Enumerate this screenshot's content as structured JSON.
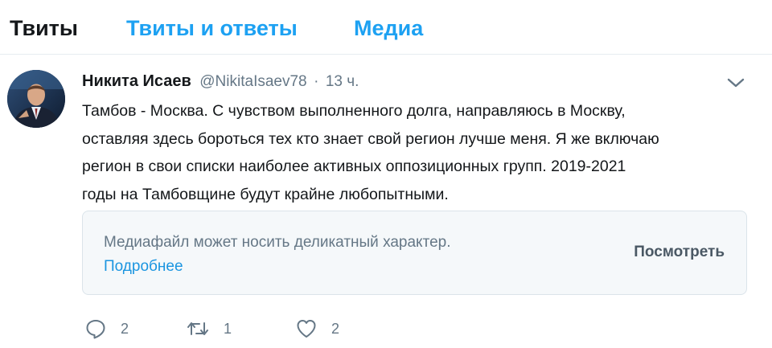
{
  "tabs": [
    {
      "label": "Твиты",
      "active": true
    },
    {
      "label": "Твиты и ответы",
      "active": false
    },
    {
      "label": "Медиа",
      "active": false
    }
  ],
  "tweet": {
    "author_name": "Никита Исаев",
    "handle": "@NikitaIsaev78",
    "separator": "·",
    "time": "13 ч.",
    "text": "Тамбов - Москва. С чувством выполненного долга, направляюсь в Москву,\nоставляя здесь бороться тех кто знает свой регион лучше меня. Я же включаю\nрегион в свои списки наиболее активных оппозиционных групп. 2019-2021\nгоды на Тамбовщине будут крайне любопытными.",
    "media": {
      "notice": "Медиафайл может носить деликатный характер.",
      "more_link": "Подробнее",
      "view_button": "Посмотреть"
    },
    "actions": {
      "replies": "2",
      "retweets": "1",
      "likes": "2"
    }
  },
  "icons": {
    "menu": "chevron-down-icon",
    "reply": "reply-icon",
    "retweet": "retweet-icon",
    "like": "heart-icon"
  },
  "colors": {
    "accent": "#1da1f2",
    "link": "#1b95e0",
    "muted": "#657786",
    "text": "#14171a",
    "media_bg": "#f5f8fa"
  }
}
